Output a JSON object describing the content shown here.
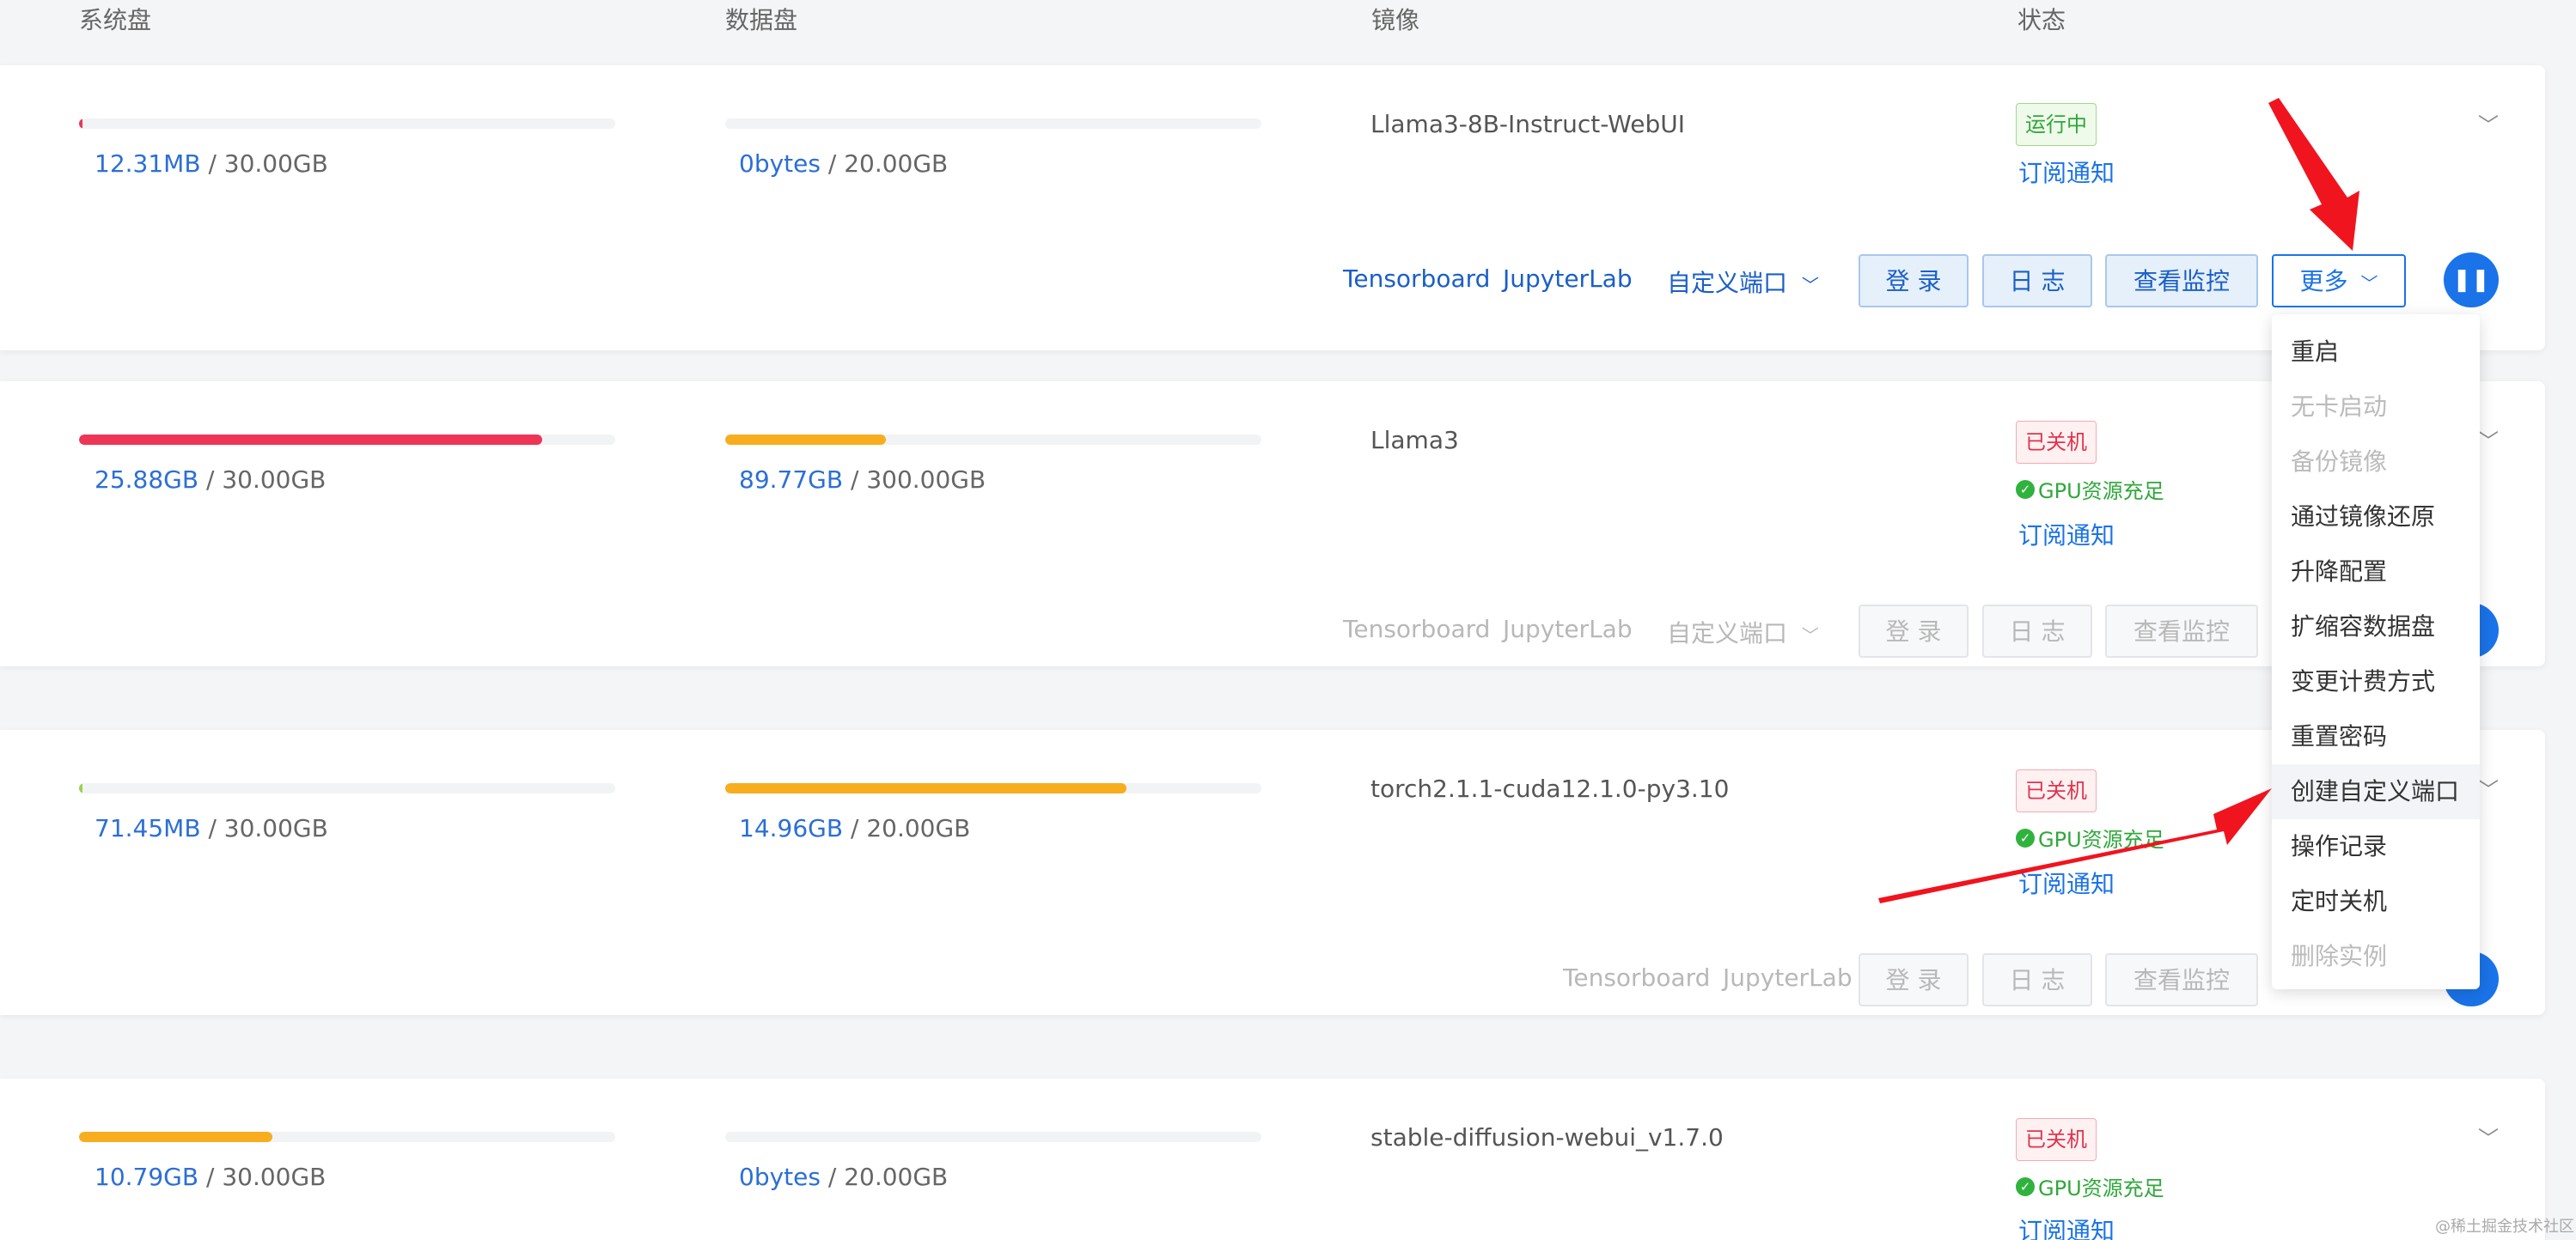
{
  "columns": {
    "system_disk": "系统盘",
    "data_disk": "数据盘",
    "image": "镜像",
    "status": "状态"
  },
  "instances": [
    {
      "system_used": "12.31MB",
      "system_total": "/ 30.00GB",
      "system_fraction": 0.0004,
      "data_used": "0bytes",
      "data_total": "/ 20.00GB",
      "data_fraction": 0.0,
      "image": "Llama3-8B-Instruct-WebUI",
      "status": "运行中",
      "gpu": "",
      "subscribe": "订阅通知",
      "links": [
        "Tensorboard",
        "JupyterLab",
        "自定义端口"
      ],
      "buttons": [
        "登 录",
        "日 志",
        "查看监控",
        "更多"
      ]
    },
    {
      "system_used": "25.88GB",
      "system_total": "/ 30.00GB",
      "system_fraction": 0.863,
      "data_used": "89.77GB",
      "data_total": "/ 300.00GB",
      "data_fraction": 0.299,
      "image": "Llama3",
      "status": "已关机",
      "gpu": "GPU资源充足",
      "subscribe": "订阅通知",
      "links": [
        "Tensorboard",
        "JupyterLab",
        "自定义端口"
      ],
      "buttons": [
        "登 录",
        "日 志",
        "查看监控"
      ]
    },
    {
      "system_used": "71.45MB",
      "system_total": "/ 30.00GB",
      "system_fraction": 0.0023,
      "data_used": "14.96GB",
      "data_total": "/ 20.00GB",
      "data_fraction": 0.748,
      "image": "torch2.1.1-cuda12.1.0-py3.10",
      "status": "已关机",
      "gpu": "GPU资源充足",
      "subscribe": "订阅通知",
      "links": [
        "Tensorboard",
        "JupyterLab"
      ],
      "buttons": [
        "登 录",
        "日 志",
        "查看监控"
      ]
    },
    {
      "system_used": "10.79GB",
      "system_total": "/ 30.00GB",
      "system_fraction": 0.36,
      "data_used": "0bytes",
      "data_total": "/ 20.00GB",
      "data_fraction": 0.0,
      "image": "stable-diffusion-webui_v1.7.0",
      "status": "已关机",
      "gpu": "GPU资源充足",
      "subscribe": "订阅通知"
    }
  ],
  "more_menu": {
    "items": [
      {
        "label": "重启",
        "enabled": true
      },
      {
        "label": "无卡启动",
        "enabled": false
      },
      {
        "label": "备份镜像",
        "enabled": false
      },
      {
        "label": "通过镜像还原",
        "enabled": true
      },
      {
        "label": "升降配置",
        "enabled": true
      },
      {
        "label": "扩缩容数据盘",
        "enabled": true
      },
      {
        "label": "变更计费方式",
        "enabled": true
      },
      {
        "label": "重置密码",
        "enabled": true
      },
      {
        "label": "创建自定义端口",
        "enabled": true
      },
      {
        "label": "操作记录",
        "enabled": true
      },
      {
        "label": "定时关机",
        "enabled": true
      },
      {
        "label": "删除实例",
        "enabled": false
      }
    ]
  },
  "colors": {
    "link_blue": "#1a73e8",
    "bar_red": "#ee3556",
    "bar_orange": "#f7ad1e",
    "running_green": "#2fa83a",
    "off_red": "#e2334b",
    "annotation_arrow": "#f0141e"
  },
  "watermark": "@稀土掘金技术社区"
}
